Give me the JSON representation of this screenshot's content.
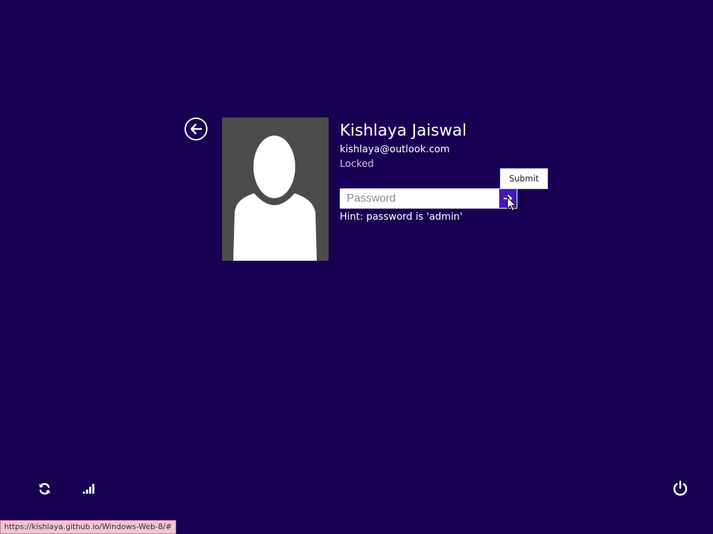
{
  "user": {
    "name": "Kishlaya Jaiswal",
    "email": "kishlaya@outlook.com",
    "status": "Locked"
  },
  "login": {
    "password_placeholder": "Password",
    "submit_tooltip": "Submit",
    "hint": "Hint: password is 'admin'"
  },
  "status_bar": {
    "url": "https://kishlaya.github.io/Windows-Web-8/#"
  },
  "icons": {
    "back": "back-arrow-icon",
    "avatar": "user-silhouette-icon",
    "submit": "arrow-right-icon",
    "ease_of_access": "ease-of-access-icon",
    "network": "network-signal-icon",
    "power": "power-icon"
  },
  "colors": {
    "background": "#180052",
    "accent": "#4617b4",
    "avatar_background": "#4c4c4c"
  }
}
